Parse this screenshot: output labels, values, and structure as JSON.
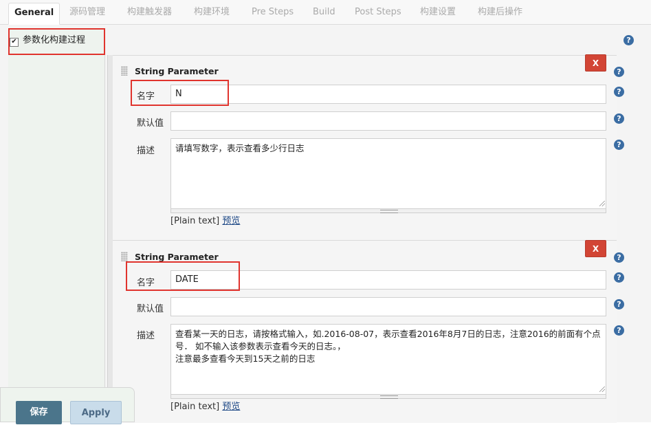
{
  "tabs": [
    {
      "label": "General",
      "active": true
    },
    {
      "label": "源码管理"
    },
    {
      "label": "构建触发器"
    },
    {
      "label": "构建环境"
    },
    {
      "label": "Pre Steps"
    },
    {
      "label": "Build"
    },
    {
      "label": "Post Steps"
    },
    {
      "label": "构建设置"
    },
    {
      "label": "构建后操作"
    }
  ],
  "parameterized": {
    "label": "参数化构建过程",
    "checked": true
  },
  "params": [
    {
      "title": "String Parameter",
      "delete_label": "X",
      "name_label": "名字",
      "name_value": "N",
      "default_label": "默认值",
      "default_value": "",
      "desc_label": "描述",
      "desc_value": "请填写数字，表示查看多少行日志",
      "plain_text": "[Plain text]",
      "preview": "预览"
    },
    {
      "title": "String Parameter",
      "delete_label": "X",
      "name_label": "名字",
      "name_value": "DATE",
      "default_label": "默认值",
      "default_value": "",
      "desc_label": "描述",
      "desc_value": "查看某一天的日志，请按格式输入，如.2016-08-07，表示查看2016年8月7日的日志，注意2016的前面有个点号． 如不输入该参数表示查看今天的日志。，\n注意最多查看今天到15天之前的日志",
      "plain_text": "[Plain text]",
      "preview": "预览"
    }
  ],
  "buttons": {
    "save": "保存",
    "apply": "Apply"
  },
  "colors": {
    "accent_red": "#e0332d",
    "delete_button": "#d24535",
    "save_button": "#4b758b",
    "help_icon": "#3b6da3"
  }
}
